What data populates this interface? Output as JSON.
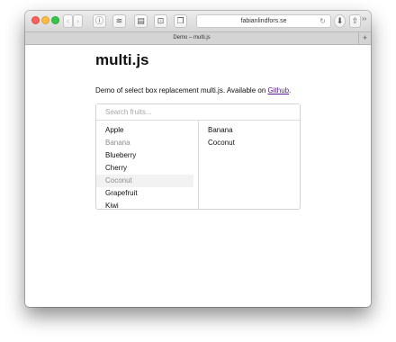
{
  "browser": {
    "url": "fabianlindfors.se",
    "tab_title": "Demo – multi.js",
    "icons": {
      "back": "chevron-left-icon",
      "forward": "chevron-right-icon",
      "info": "info-icon",
      "layers": "layers-icon",
      "sidebar": "sidebar-icon",
      "screenshot": "screenshot-icon",
      "tabs": "tabs-icon",
      "reload": "reload-icon",
      "download": "download-icon",
      "share": "share-icon",
      "overview": "tab-overview-icon",
      "more": "more-icon",
      "new_tab": "plus-icon"
    }
  },
  "page": {
    "title": "multi.js",
    "description_prefix": "Demo of select box replacement multi.js. Available on ",
    "github_link": "Github",
    "description_suffix": "."
  },
  "multi_select": {
    "search_placeholder": "Search fruits...",
    "search_value": "",
    "non_selected": [
      {
        "label": "Apple",
        "state": "normal"
      },
      {
        "label": "Banana",
        "state": "selected"
      },
      {
        "label": "Blueberry",
        "state": "normal"
      },
      {
        "label": "Cherry",
        "state": "normal"
      },
      {
        "label": "Coconut",
        "state": "selected-hover"
      },
      {
        "label": "Grapefruit",
        "state": "normal"
      },
      {
        "label": "Kiwi",
        "state": "normal"
      }
    ],
    "selected": [
      {
        "label": "Banana"
      },
      {
        "label": "Coconut"
      }
    ]
  },
  "colors": {
    "link": "#551a8b",
    "disabled_text": "#8e8e8e",
    "close": "#fc605c",
    "minimize": "#fdbc40",
    "maximize": "#34c84a"
  }
}
